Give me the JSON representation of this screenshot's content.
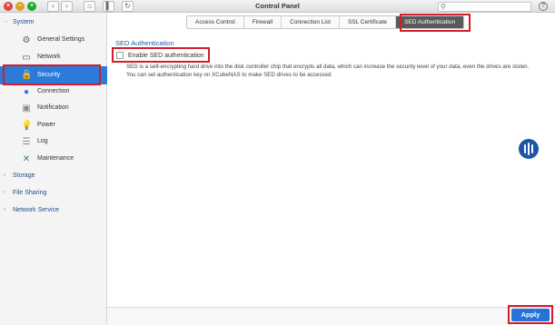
{
  "window": {
    "title": "Control Panel",
    "search_placeholder": ""
  },
  "sidebar": {
    "system": "System",
    "items": [
      {
        "label": "General Settings",
        "icon": "gear-icon"
      },
      {
        "label": "Network",
        "icon": "network-icon"
      },
      {
        "label": "Security",
        "icon": "lock-icon"
      },
      {
        "label": "Connection",
        "icon": "globe-icon"
      },
      {
        "label": "Notification",
        "icon": "notification-icon"
      },
      {
        "label": "Power",
        "icon": "bulb-icon"
      },
      {
        "label": "Log",
        "icon": "log-icon"
      },
      {
        "label": "Maintenance",
        "icon": "tools-icon"
      }
    ],
    "groups": [
      "Storage",
      "File Sharing",
      "Network Service"
    ]
  },
  "tabs": [
    "Access Control",
    "Firewall",
    "Connection List",
    "SSL Certificate",
    "SED Authentication"
  ],
  "content": {
    "section_title": "SED Authentication",
    "checkbox_label": "Enable SED authentication",
    "description": "SED is a self-encrypting hard drive into the disk controller chip that encrypts all data, which can increase the security level of your data, even the drives are stolen. You can set authentication key on XCubeNAS to make SED drives to be accessed."
  },
  "footer": {
    "apply_label": "Apply"
  },
  "colors": {
    "accent": "#2d7bd8",
    "highlight": "#d31d2b",
    "apply": "#2871d6"
  }
}
